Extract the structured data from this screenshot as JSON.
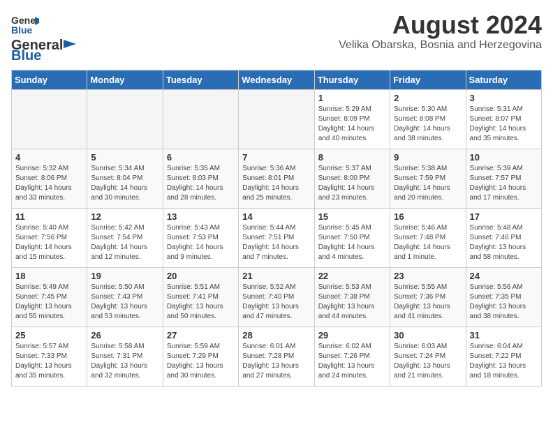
{
  "header": {
    "logo_general": "General",
    "logo_blue": "Blue",
    "main_title": "August 2024",
    "subtitle": "Velika Obarska, Bosnia and Herzegovina"
  },
  "weekdays": [
    "Sunday",
    "Monday",
    "Tuesday",
    "Wednesday",
    "Thursday",
    "Friday",
    "Saturday"
  ],
  "weeks": [
    [
      {
        "day": "",
        "empty": true
      },
      {
        "day": "",
        "empty": true
      },
      {
        "day": "",
        "empty": true
      },
      {
        "day": "",
        "empty": true
      },
      {
        "day": "1",
        "sunrise": "5:29 AM",
        "sunset": "8:09 PM",
        "daylight": "14 hours and 40 minutes."
      },
      {
        "day": "2",
        "sunrise": "5:30 AM",
        "sunset": "8:08 PM",
        "daylight": "14 hours and 38 minutes."
      },
      {
        "day": "3",
        "sunrise": "5:31 AM",
        "sunset": "8:07 PM",
        "daylight": "14 hours and 35 minutes."
      }
    ],
    [
      {
        "day": "4",
        "sunrise": "5:32 AM",
        "sunset": "8:06 PM",
        "daylight": "14 hours and 33 minutes."
      },
      {
        "day": "5",
        "sunrise": "5:34 AM",
        "sunset": "8:04 PM",
        "daylight": "14 hours and 30 minutes."
      },
      {
        "day": "6",
        "sunrise": "5:35 AM",
        "sunset": "8:03 PM",
        "daylight": "14 hours and 28 minutes."
      },
      {
        "day": "7",
        "sunrise": "5:36 AM",
        "sunset": "8:01 PM",
        "daylight": "14 hours and 25 minutes."
      },
      {
        "day": "8",
        "sunrise": "5:37 AM",
        "sunset": "8:00 PM",
        "daylight": "14 hours and 23 minutes."
      },
      {
        "day": "9",
        "sunrise": "5:38 AM",
        "sunset": "7:59 PM",
        "daylight": "14 hours and 20 minutes."
      },
      {
        "day": "10",
        "sunrise": "5:39 AM",
        "sunset": "7:57 PM",
        "daylight": "14 hours and 17 minutes."
      }
    ],
    [
      {
        "day": "11",
        "sunrise": "5:40 AM",
        "sunset": "7:56 PM",
        "daylight": "14 hours and 15 minutes."
      },
      {
        "day": "12",
        "sunrise": "5:42 AM",
        "sunset": "7:54 PM",
        "daylight": "14 hours and 12 minutes."
      },
      {
        "day": "13",
        "sunrise": "5:43 AM",
        "sunset": "7:53 PM",
        "daylight": "14 hours and 9 minutes."
      },
      {
        "day": "14",
        "sunrise": "5:44 AM",
        "sunset": "7:51 PM",
        "daylight": "14 hours and 7 minutes."
      },
      {
        "day": "15",
        "sunrise": "5:45 AM",
        "sunset": "7:50 PM",
        "daylight": "14 hours and 4 minutes."
      },
      {
        "day": "16",
        "sunrise": "5:46 AM",
        "sunset": "7:48 PM",
        "daylight": "14 hours and 1 minute."
      },
      {
        "day": "17",
        "sunrise": "5:48 AM",
        "sunset": "7:46 PM",
        "daylight": "13 hours and 58 minutes."
      }
    ],
    [
      {
        "day": "18",
        "sunrise": "5:49 AM",
        "sunset": "7:45 PM",
        "daylight": "13 hours and 55 minutes."
      },
      {
        "day": "19",
        "sunrise": "5:50 AM",
        "sunset": "7:43 PM",
        "daylight": "13 hours and 53 minutes."
      },
      {
        "day": "20",
        "sunrise": "5:51 AM",
        "sunset": "7:41 PM",
        "daylight": "13 hours and 50 minutes."
      },
      {
        "day": "21",
        "sunrise": "5:52 AM",
        "sunset": "7:40 PM",
        "daylight": "13 hours and 47 minutes."
      },
      {
        "day": "22",
        "sunrise": "5:53 AM",
        "sunset": "7:38 PM",
        "daylight": "13 hours and 44 minutes."
      },
      {
        "day": "23",
        "sunrise": "5:55 AM",
        "sunset": "7:36 PM",
        "daylight": "13 hours and 41 minutes."
      },
      {
        "day": "24",
        "sunrise": "5:56 AM",
        "sunset": "7:35 PM",
        "daylight": "13 hours and 38 minutes."
      }
    ],
    [
      {
        "day": "25",
        "sunrise": "5:57 AM",
        "sunset": "7:33 PM",
        "daylight": "13 hours and 35 minutes."
      },
      {
        "day": "26",
        "sunrise": "5:58 AM",
        "sunset": "7:31 PM",
        "daylight": "13 hours and 32 minutes."
      },
      {
        "day": "27",
        "sunrise": "5:59 AM",
        "sunset": "7:29 PM",
        "daylight": "13 hours and 30 minutes."
      },
      {
        "day": "28",
        "sunrise": "6:01 AM",
        "sunset": "7:28 PM",
        "daylight": "13 hours and 27 minutes."
      },
      {
        "day": "29",
        "sunrise": "6:02 AM",
        "sunset": "7:26 PM",
        "daylight": "13 hours and 24 minutes."
      },
      {
        "day": "30",
        "sunrise": "6:03 AM",
        "sunset": "7:24 PM",
        "daylight": "13 hours and 21 minutes."
      },
      {
        "day": "31",
        "sunrise": "6:04 AM",
        "sunset": "7:22 PM",
        "daylight": "13 hours and 18 minutes."
      }
    ]
  ]
}
